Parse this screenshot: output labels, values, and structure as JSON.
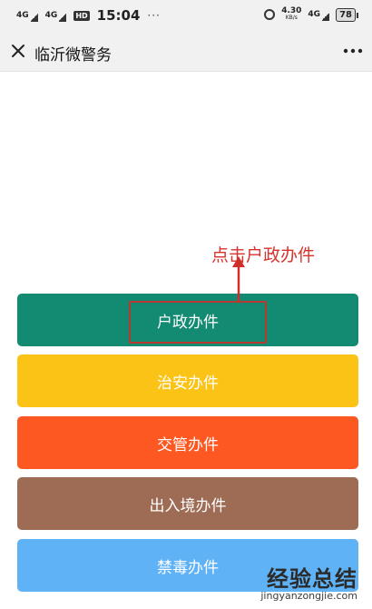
{
  "status_bar": {
    "signal_1": "4G",
    "signal_2": "4G",
    "hd_badge": "HD",
    "time": "15:04",
    "dots": "···",
    "net_speed": "4.30",
    "net_speed_unit": "KB/s",
    "network_type": "4G",
    "battery": "78"
  },
  "title_bar": {
    "title": "临沂微警务",
    "close_icon": "close-icon",
    "more_icon": "more-dots-icon"
  },
  "menu": {
    "items": [
      {
        "label": "户政办件",
        "color": "#138a72"
      },
      {
        "label": "治安办件",
        "color": "#fbc316"
      },
      {
        "label": "交管办件",
        "color": "#fd5722"
      },
      {
        "label": "出入境办件",
        "color": "#9e6b55"
      },
      {
        "label": "禁毒办件",
        "color": "#60b2f6"
      }
    ]
  },
  "annotation": {
    "text": "点击户政办件",
    "color": "#d7322c"
  },
  "watermark": {
    "main": "经验总结",
    "sub": "jingyanzongjie.com"
  }
}
